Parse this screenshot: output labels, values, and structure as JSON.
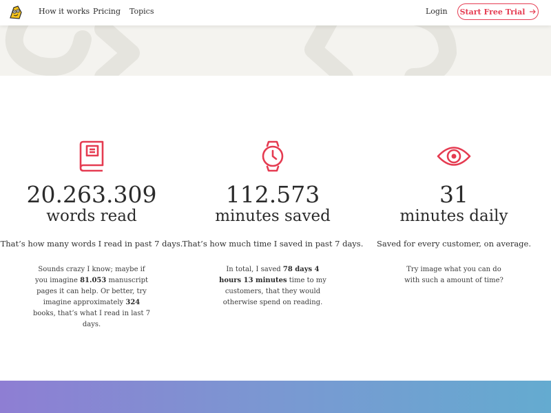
{
  "nav": {
    "how_it_works": "How it works",
    "pricing": "Pricing",
    "topics": "Topics",
    "login": "Login",
    "cta": "Start Free Trial"
  },
  "colors": {
    "accent": "#e53b51",
    "hero_bg": "#f4f3ef",
    "gradient_start": "#8e7ed3",
    "gradient_end": "#64abd0"
  },
  "stats": [
    {
      "icon": "book-icon",
      "number": "20.263.309",
      "unit": "words read",
      "summary": "That’s how many words I read in past 7 days.",
      "detail_1": "Sounds crazy I know; maybe if you imagine ",
      "detail_bold_1": "81.053",
      "detail_2": " manuscript pages it can help. Or better, try imagine approximately ",
      "detail_bold_2": "324",
      "detail_3": " books, that’s what I read in last 7 days."
    },
    {
      "icon": "watch-icon",
      "number": "112.573",
      "unit": "minutes saved",
      "summary": "That’s how much time I saved in past 7 days.",
      "detail_1": "In total, I saved ",
      "detail_bold_1": "78 days 4 hours 13 minutes",
      "detail_2": " time to my customers, that they would otherwise spend on reading."
    },
    {
      "icon": "eye-icon",
      "number": "31",
      "unit": "minutes daily",
      "summary": "Saved for every customer, on average.",
      "detail_1": "Try image what you can do with such a amount of time?"
    }
  ]
}
